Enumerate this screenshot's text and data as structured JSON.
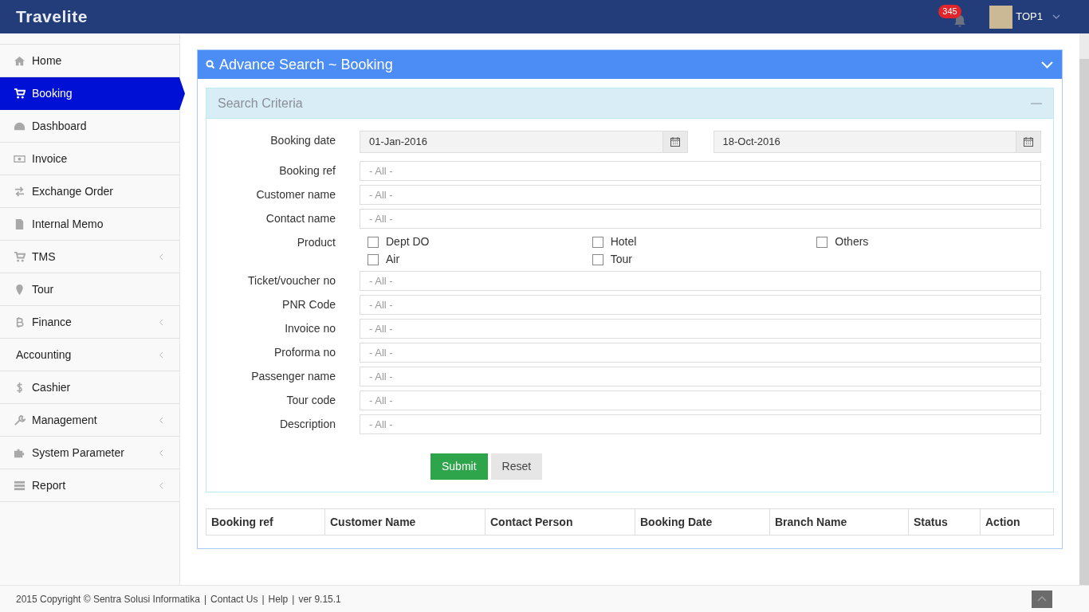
{
  "header": {
    "logo": "Travelite",
    "notification_count": "345",
    "user": "TOP1"
  },
  "sidebar": {
    "items": [
      {
        "label": "Home",
        "selected": false,
        "has_submenu": false
      },
      {
        "label": "Booking",
        "selected": true,
        "has_submenu": false
      },
      {
        "label": "Dashboard",
        "selected": false,
        "has_submenu": false
      },
      {
        "label": "Invoice",
        "selected": false,
        "has_submenu": false
      },
      {
        "label": "Exchange Order",
        "selected": false,
        "has_submenu": false
      },
      {
        "label": "Internal Memo",
        "selected": false,
        "has_submenu": false
      },
      {
        "label": "TMS",
        "selected": false,
        "has_submenu": true
      },
      {
        "label": "Tour",
        "selected": false,
        "has_submenu": false
      },
      {
        "label": "Finance",
        "selected": false,
        "has_submenu": true
      },
      {
        "label": "Accounting",
        "selected": false,
        "has_submenu": true
      },
      {
        "label": "Cashier",
        "selected": false,
        "has_submenu": false
      },
      {
        "label": "Management",
        "selected": false,
        "has_submenu": true
      },
      {
        "label": "System Parameter",
        "selected": false,
        "has_submenu": true
      },
      {
        "label": "Report",
        "selected": false,
        "has_submenu": true
      }
    ]
  },
  "panel": {
    "title": "Advance Search ~ Booking",
    "criteria": {
      "title": "Search Criteria",
      "fields": [
        {
          "kind": "daterange",
          "label": "Booking date",
          "from": "01-Jan-2016",
          "to": "18-Oct-2016"
        },
        {
          "kind": "text",
          "label": "Booking ref",
          "placeholder": "- All -"
        },
        {
          "kind": "text",
          "label": "Customer name",
          "placeholder": "- All -"
        },
        {
          "kind": "text",
          "label": "Contact name",
          "placeholder": "- All -"
        },
        {
          "kind": "checkboxes",
          "label": "Product",
          "options": [
            {
              "label": "Dept DO",
              "checked": false
            },
            {
              "label": "Hotel",
              "checked": false
            },
            {
              "label": "Others",
              "checked": false
            },
            {
              "label": "Air",
              "checked": false
            },
            {
              "label": "Tour",
              "checked": false
            }
          ]
        },
        {
          "kind": "text",
          "label": "Ticket/voucher no",
          "placeholder": "- All -"
        },
        {
          "kind": "text",
          "label": "PNR Code",
          "placeholder": "- All -"
        },
        {
          "kind": "text",
          "label": "Invoice no",
          "placeholder": "- All -"
        },
        {
          "kind": "text",
          "label": "Proforma no",
          "placeholder": "- All -"
        },
        {
          "kind": "text",
          "label": "Passenger name",
          "placeholder": "- All -"
        },
        {
          "kind": "text",
          "label": "Tour code",
          "placeholder": "- All -"
        },
        {
          "kind": "text",
          "label": "Description",
          "placeholder": "- All -"
        }
      ],
      "buttons": [
        "Submit",
        "Reset"
      ]
    },
    "table": {
      "columns": [
        "Booking ref",
        "Customer Name",
        "Contact Person",
        "Booking Date",
        "Branch Name",
        "Status",
        "Action"
      ]
    }
  },
  "footer": [
    "2015 Copyright © Sentra Solusi Informatika",
    "|",
    "Contact Us",
    "|",
    "Help",
    "|",
    "ver 9.15.1"
  ]
}
